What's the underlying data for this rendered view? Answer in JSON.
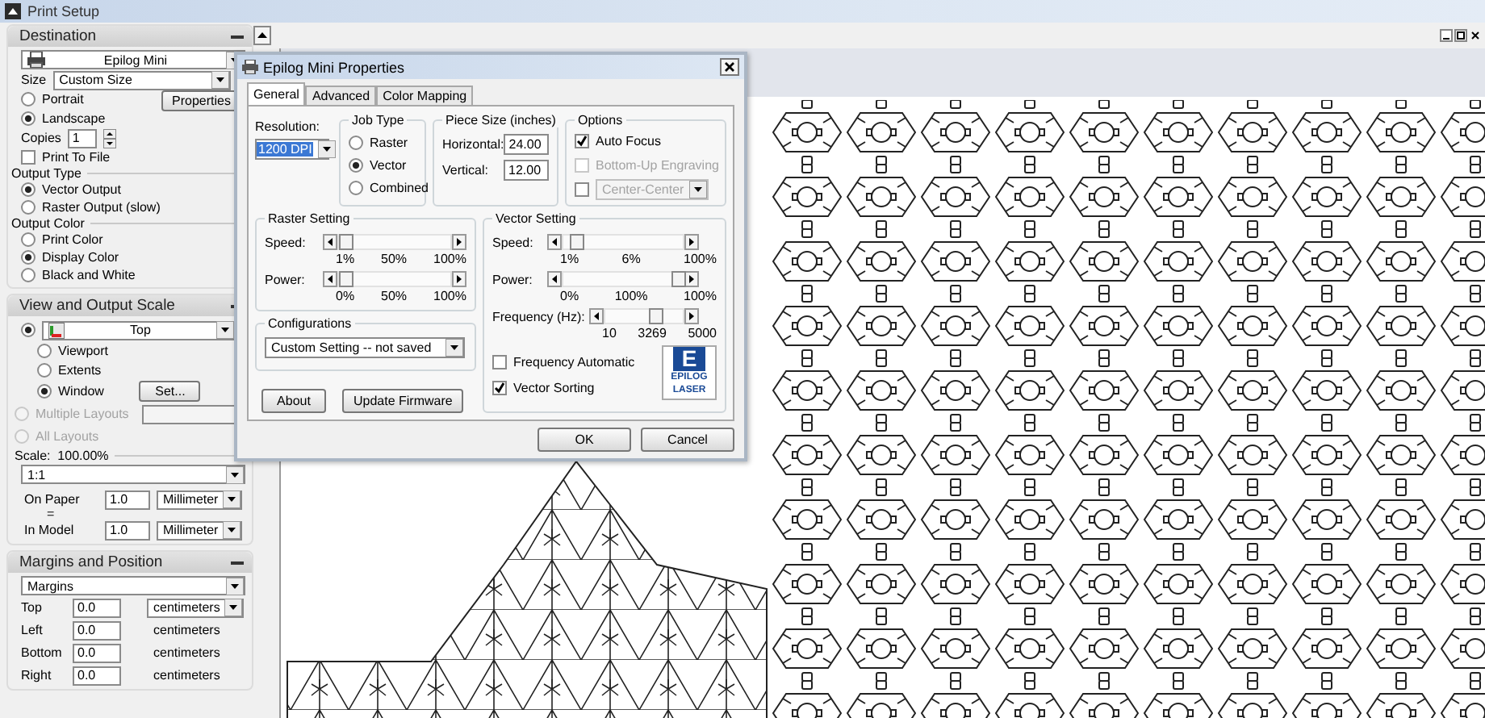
{
  "window": {
    "title": "Print Setup"
  },
  "sidebar": {
    "destination": {
      "title": "Destination",
      "printer": "Epilog Mini",
      "size": {
        "label": "Size",
        "value": "Custom Size"
      },
      "orientation": [
        {
          "label": "Portrait",
          "selected": false
        },
        {
          "label": "Landscape",
          "selected": true
        }
      ],
      "properties_button": "Properties",
      "copies": {
        "label": "Copies",
        "value": "1"
      },
      "print_to_file": {
        "label": "Print To File",
        "checked": false
      },
      "output_type": {
        "title": "Output Type",
        "options": [
          {
            "label": "Vector Output",
            "selected": true
          },
          {
            "label": "Raster Output (slow)",
            "selected": false
          }
        ]
      },
      "output_color": {
        "title": "Output Color",
        "options": [
          {
            "label": "Print Color",
            "selected": false
          },
          {
            "label": "Display Color",
            "selected": true
          },
          {
            "label": "Black and White",
            "selected": false
          }
        ]
      }
    },
    "view_scale": {
      "title": "View and Output Scale",
      "view": {
        "value": "Top",
        "selected": true
      },
      "modes": [
        {
          "label": "Viewport",
          "selected": false
        },
        {
          "label": "Extents",
          "selected": false
        },
        {
          "label": "Window",
          "selected": true
        }
      ],
      "set_button": "Set...",
      "layouts": [
        {
          "label": "Multiple Layouts",
          "selected": false,
          "disabled": true
        },
        {
          "label": "All Layouts",
          "selected": false,
          "disabled": true
        }
      ],
      "scale_label": "Scale:  100.00%",
      "scale_value": "1:1",
      "on_paper": {
        "label": "On Paper",
        "value": "1.0",
        "unit": "Millimeter"
      },
      "equals": "=",
      "in_model": {
        "label": "In Model",
        "value": "1.0",
        "unit": "Millimeter"
      }
    },
    "margins": {
      "title": "Margins and Position",
      "mode": "Margins",
      "rows": [
        {
          "kind": "dropdown",
          "label": "Top",
          "value": "0.0",
          "unit": "centimeters"
        },
        {
          "kind": "text",
          "label": "Left",
          "value": "0.0",
          "unit": "centimeters"
        },
        {
          "kind": "text",
          "label": "Bottom",
          "value": "0.0",
          "unit": "centimeters"
        },
        {
          "kind": "text",
          "label": "Right",
          "value": "0.0",
          "unit": "centimeters"
        }
      ]
    }
  },
  "dialog": {
    "title": "Epilog Mini Properties",
    "tabs": [
      {
        "label": "General",
        "selected": true
      },
      {
        "label": "Advanced",
        "selected": false
      },
      {
        "label": "Color Mapping",
        "selected": false
      }
    ],
    "resolution": {
      "label": "Resolution:",
      "value": "1200 DPI"
    },
    "job_type": {
      "title": "Job Type",
      "options": [
        {
          "label": "Raster",
          "selected": false
        },
        {
          "label": "Vector",
          "selected": true
        },
        {
          "label": "Combined",
          "selected": false
        }
      ]
    },
    "piece_size": {
      "title": "Piece Size (inches)",
      "fields": [
        {
          "label": "Horizontal:",
          "value": "24.00"
        },
        {
          "label": "Vertical:",
          "value": "12.00"
        }
      ]
    },
    "options": {
      "title": "Options",
      "items": [
        {
          "kind": "checkbox",
          "label": "Auto Focus",
          "checked": true,
          "disabled": false
        },
        {
          "kind": "checkbox",
          "label": "Bottom-Up Engraving",
          "checked": false,
          "disabled": true
        },
        {
          "kind": "dropdown",
          "value": "Center-Center",
          "checked": false,
          "disabled": true
        }
      ]
    },
    "raster": {
      "title": "Raster Setting",
      "sliders": [
        {
          "label": "Speed:",
          "level": 0.0,
          "ticks": [
            "1%",
            "50%",
            "100%"
          ]
        },
        {
          "label": "Power:",
          "level": 0.0,
          "ticks": [
            "0%",
            "50%",
            "100%"
          ]
        }
      ]
    },
    "vector": {
      "title": "Vector Setting",
      "sliders": [
        {
          "label": "Speed:",
          "level": 0.06,
          "ticks": [
            "1%",
            "6%",
            "100%"
          ]
        },
        {
          "label": "Power:",
          "level": 1.0,
          "ticks": [
            "0%",
            "100%",
            "100%"
          ]
        },
        {
          "label": "Frequency (Hz):",
          "level": 0.65,
          "ticks": [
            "10",
            "3269",
            "5000"
          ]
        }
      ],
      "checkboxes": [
        {
          "label": "Frequency Automatic",
          "checked": false
        },
        {
          "label": "Vector Sorting",
          "checked": true
        }
      ]
    },
    "logo": {
      "mark": "E",
      "lines": [
        "EPILOG",
        "LASER"
      ]
    },
    "configurations": {
      "title": "Configurations",
      "value": "Custom Setting -- not saved"
    },
    "buttons": [
      "About",
      "Update Firmware"
    ],
    "footer_buttons": [
      "OK",
      "Cancel"
    ]
  }
}
